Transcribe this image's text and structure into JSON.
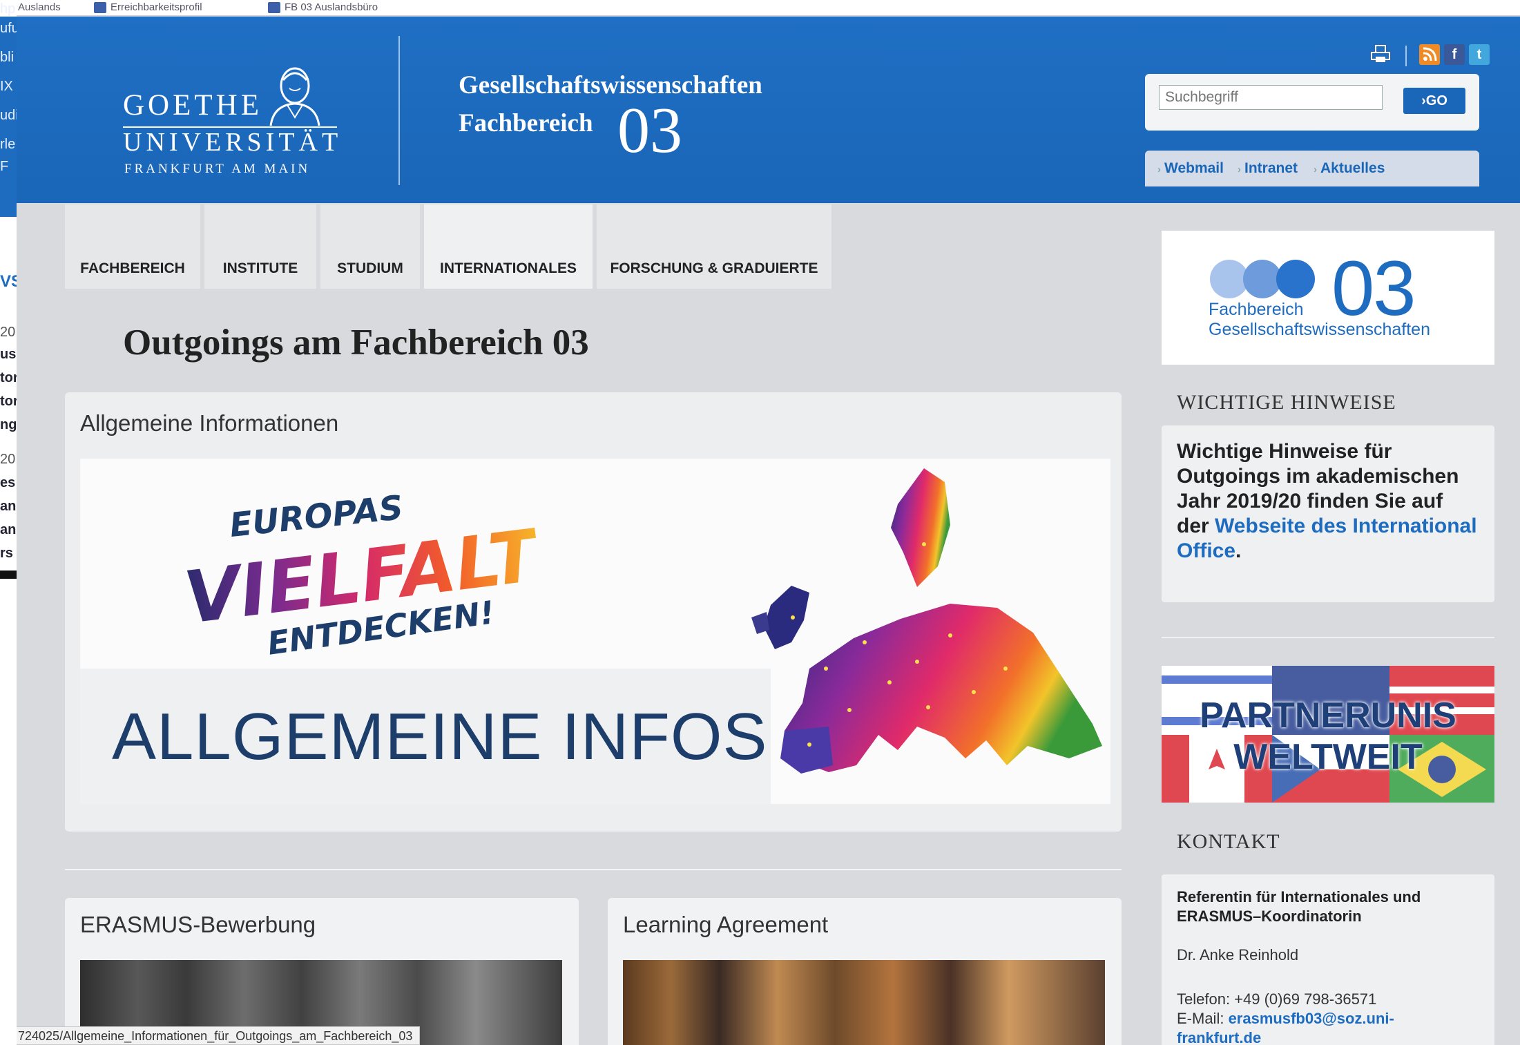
{
  "browser": {
    "bookmarks": [
      {
        "label": "Auslands"
      },
      {
        "label": "Erreichbarkeitsprofil"
      },
      {
        "label": "FB 03 Auslandsbüro"
      }
    ],
    "left_fragments": [
      "hp",
      "ufu",
      "bli",
      "IX",
      "udi",
      "rle",
      "F",
      "VS",
      "20",
      "us",
      "tor",
      "tor",
      "ng",
      "20",
      "es",
      "an",
      "an",
      "rs"
    ],
    "status_url": "724025/Allgemeine_Informationen_für_Outgoings_am_Fachbereich_03"
  },
  "header": {
    "logo": {
      "line1": "GOETHE",
      "line2": "UNIVERSITÄT",
      "line3": "FRANKFURT AM MAIN"
    },
    "dept_title": "Gesellschaftswissenschaften",
    "dept_sub": "Fachbereich",
    "dept_number": "03",
    "search": {
      "placeholder": "Suchbegriff",
      "value": "",
      "go_label": "GO"
    },
    "quicklinks": [
      "Webmail",
      "Intranet",
      "Aktuelles"
    ]
  },
  "nav": {
    "tabs": [
      {
        "label": "FACHBEREICH"
      },
      {
        "label": "INSTITUTE"
      },
      {
        "label": "STUDIUM"
      },
      {
        "label": "INTERNATIONALES",
        "active": true
      },
      {
        "label": "FORSCHUNG & GRADUIERTE"
      }
    ]
  },
  "main": {
    "page_title": "Outgoings am Fachbereich 03",
    "allgemein": {
      "title": "Allgemeine Informationen",
      "banner_europas": "EUROPAS",
      "banner_vielfalt": "VIELFALT",
      "banner_entdecken": "ENTDECKEN!",
      "banner_title": "ALLGEMEINE INFOS"
    },
    "cards": [
      {
        "title": "ERASMUS-Bewerbung"
      },
      {
        "title": "Learning Agreement"
      }
    ]
  },
  "sidebar": {
    "fb_logo": {
      "number": "03",
      "line1": "Fachbereich",
      "line2": "Gesellschaftswissenschaften"
    },
    "hinweise": {
      "heading": "WICHTIGE HINWEISE",
      "text_before": "Wichtige Hinweise für Outgoings im akademischen Jahr 2019/20 finden Sie auf der ",
      "link": "Webseite des International Office",
      "text_after": "."
    },
    "partner": {
      "line1": "PARTNERUNIS",
      "line2": "WELTWEIT"
    },
    "kontakt": {
      "heading": "KONTAKT",
      "role_line1": "Referentin für Internationales und",
      "role_line2": "ERASMUS–Koordinatorin",
      "name": "Dr. Anke Reinhold",
      "phone": "Telefon: +49 (0)69 798-36571",
      "email_label": "E-Mail: ",
      "email_line1": "erasmusfb03@soz.uni-",
      "email_line2": "frankfurt.de"
    }
  },
  "colors": {
    "brand_blue": "#1e6cc0",
    "header_blue": "#1f6fc4",
    "page_bg": "#d8dadd",
    "accent_orange": "#f08a24"
  },
  "icons": [
    "print-icon",
    "rss-icon",
    "facebook-icon",
    "twitter-icon"
  ]
}
